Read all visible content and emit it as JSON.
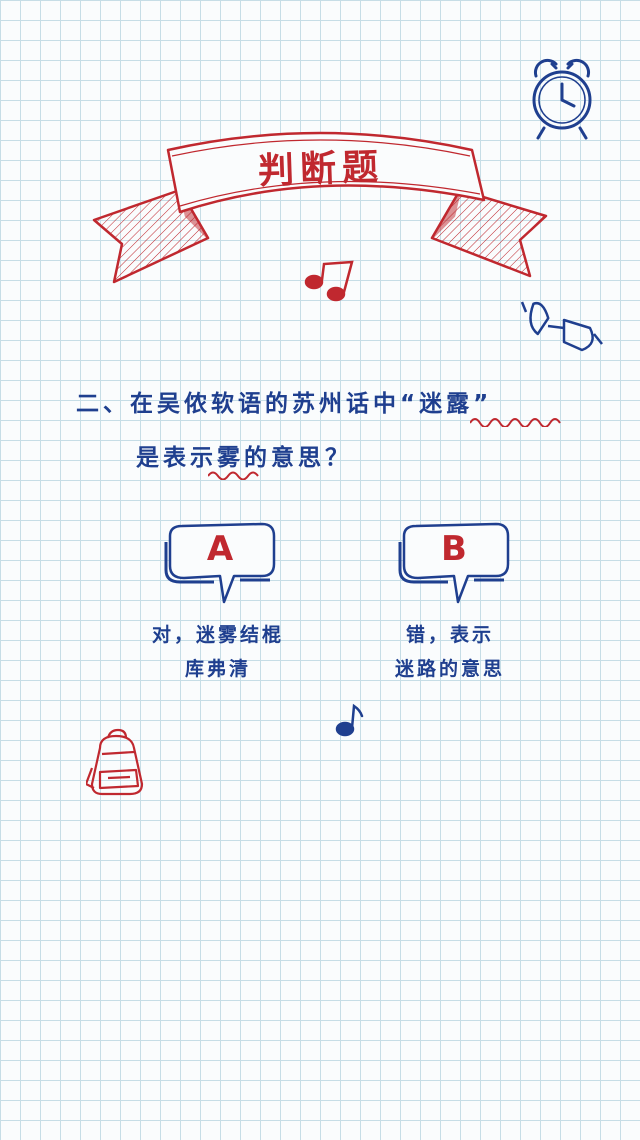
{
  "header": {
    "title": "判断题"
  },
  "question": {
    "line1_prefix": "二、在吴侬软语的苏州话中“",
    "line1_highlight": "迷露",
    "line1_suffix": "”",
    "line2_prefix": "是表示",
    "line2_highlight": "雾",
    "line2_suffix": "的意思？"
  },
  "options": [
    {
      "letter": "A",
      "line1": "对，迷雾结棍",
      "line2": "库弗清"
    },
    {
      "letter": "B",
      "line1": "错，表示",
      "line2": "迷路的意思"
    }
  ],
  "colors": {
    "red": "#c0282f",
    "blue": "#1f3f8f",
    "grid": "#c6dde6"
  },
  "icons": [
    "alarm-clock-icon",
    "glasses-icon",
    "music-note-icon",
    "backpack-icon"
  ]
}
